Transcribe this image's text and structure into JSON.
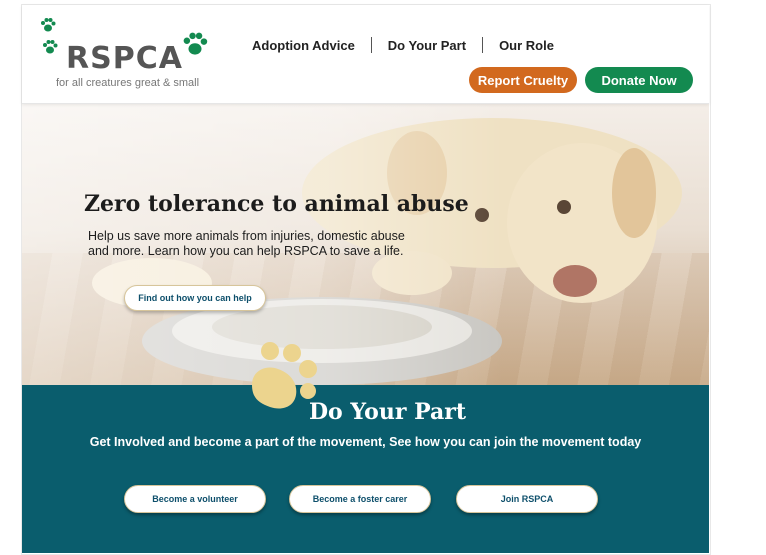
{
  "brand": {
    "name": "RSPCA",
    "tagline": "for all creatures great & small",
    "color": "#138a50"
  },
  "nav": {
    "items": [
      {
        "label": "Adoption Advice"
      },
      {
        "label": "Do Your Part"
      },
      {
        "label": "Our Role"
      }
    ]
  },
  "actions": {
    "report_label": "Report Cruelty",
    "donate_label": "Donate Now"
  },
  "hero": {
    "title": "Zero tolerance to animal abuse",
    "subtitle": "Help us save more animals from injuries, domestic abuse and more. Learn how you can help RSPCA to save a life.",
    "button_label": "Find out how you can help"
  },
  "section": {
    "title": "Do Your Part",
    "subtitle": "Get Involved and become a part of the movement, See how you can join the movement today",
    "buttons": [
      {
        "label": "Become a volunteer"
      },
      {
        "label": "Become a foster carer"
      },
      {
        "label": "Join RSPCA"
      }
    ]
  },
  "colors": {
    "accent_orange": "#d2691e",
    "accent_green": "#138a50",
    "section_teal": "#0a5d6d",
    "paw_gold": "#ecd48e"
  },
  "icons": [
    "paw-icon",
    "dog-photo"
  ]
}
